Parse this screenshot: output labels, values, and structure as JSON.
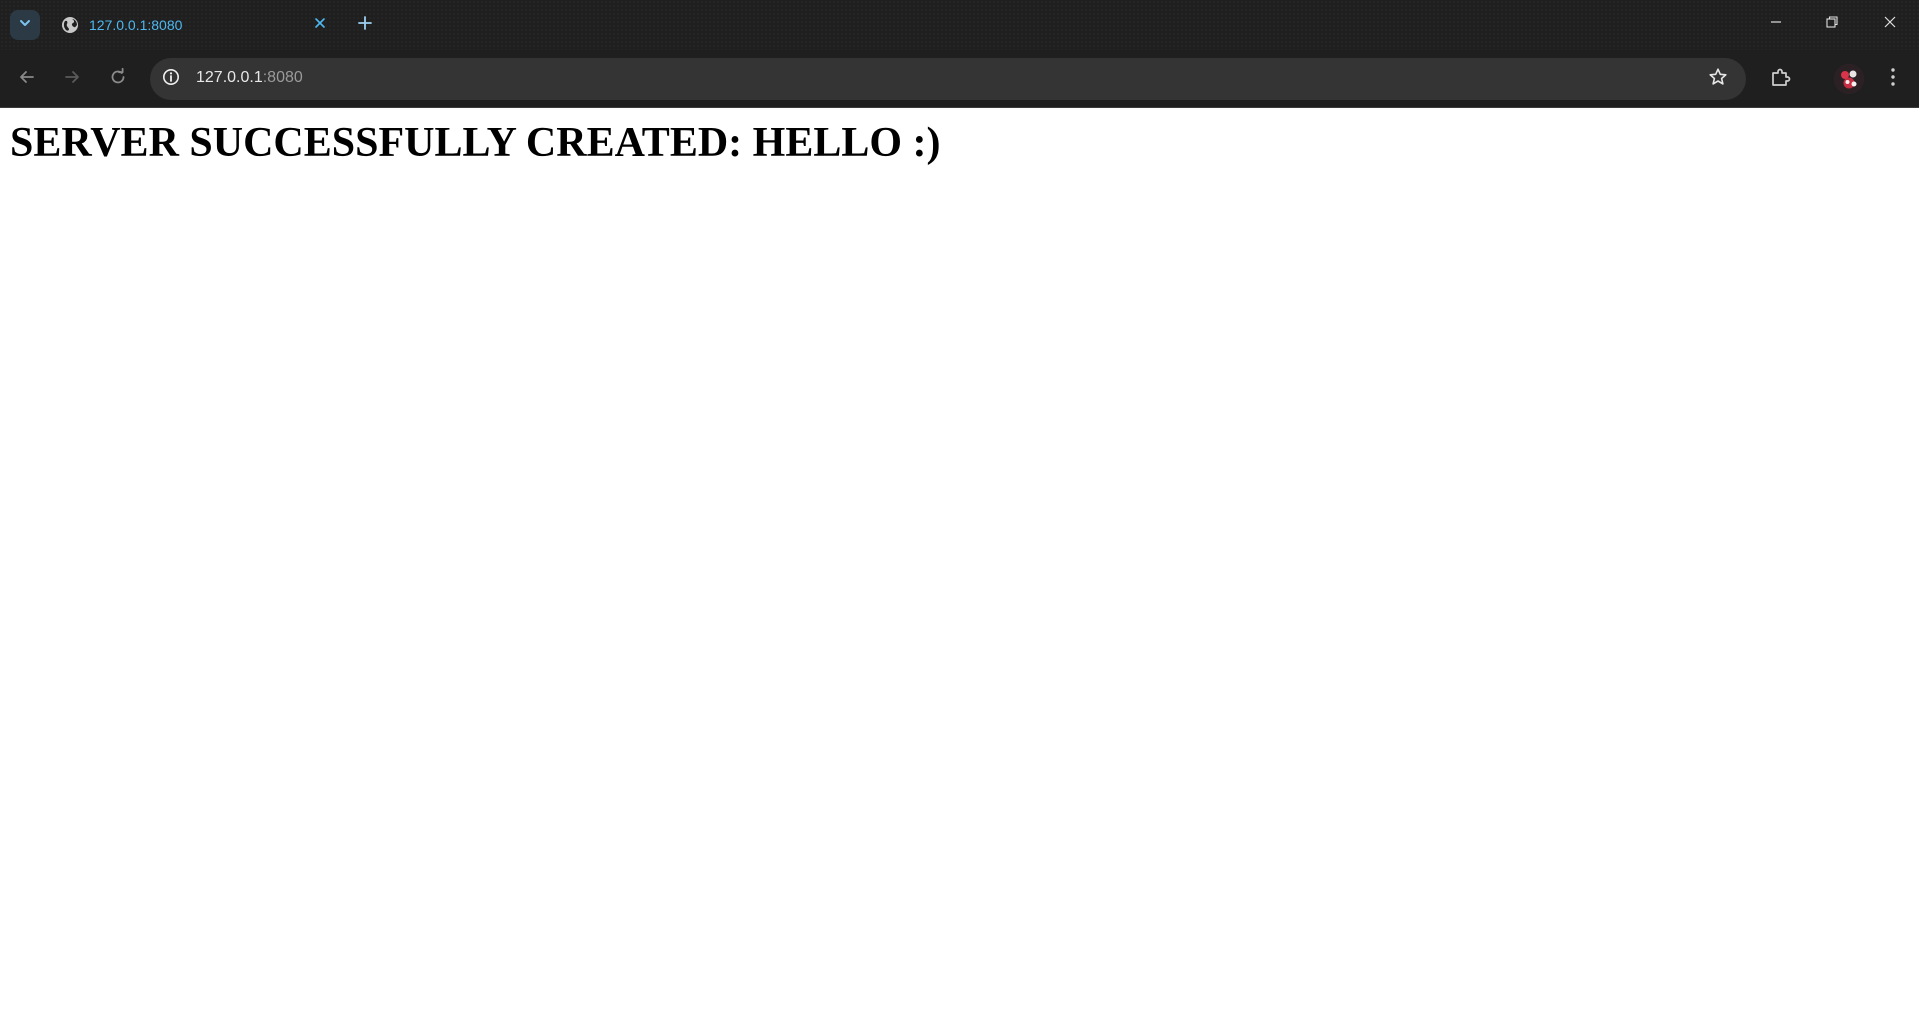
{
  "browser": {
    "tab": {
      "title": "127.0.0.1:8080",
      "favicon": "globe-icon",
      "title_color": "#4db8f0"
    },
    "address_bar": {
      "host": "127.0.0.1",
      "port": ":8080"
    },
    "icons": {
      "tab_search": "chevron-down-icon",
      "tab_close": "close-icon",
      "new_tab": "plus-icon",
      "back": "arrow-left-icon",
      "forward": "arrow-right-icon",
      "reload": "reload-icon",
      "site_info": "info-icon",
      "bookmark": "star-icon",
      "extensions": "puzzle-icon",
      "profile": "avatar",
      "menu": "kebab-menu-icon",
      "minimize": "minimize-icon",
      "restore": "restore-icon",
      "close_window": "close-icon"
    },
    "colors": {
      "chrome_bg": "#1f1f1f",
      "omnibox_bg": "#343434",
      "accent": "#4db8f0"
    }
  },
  "page": {
    "heading": "SERVER SUCCESSFULLY CREATED: HELLO :)"
  }
}
